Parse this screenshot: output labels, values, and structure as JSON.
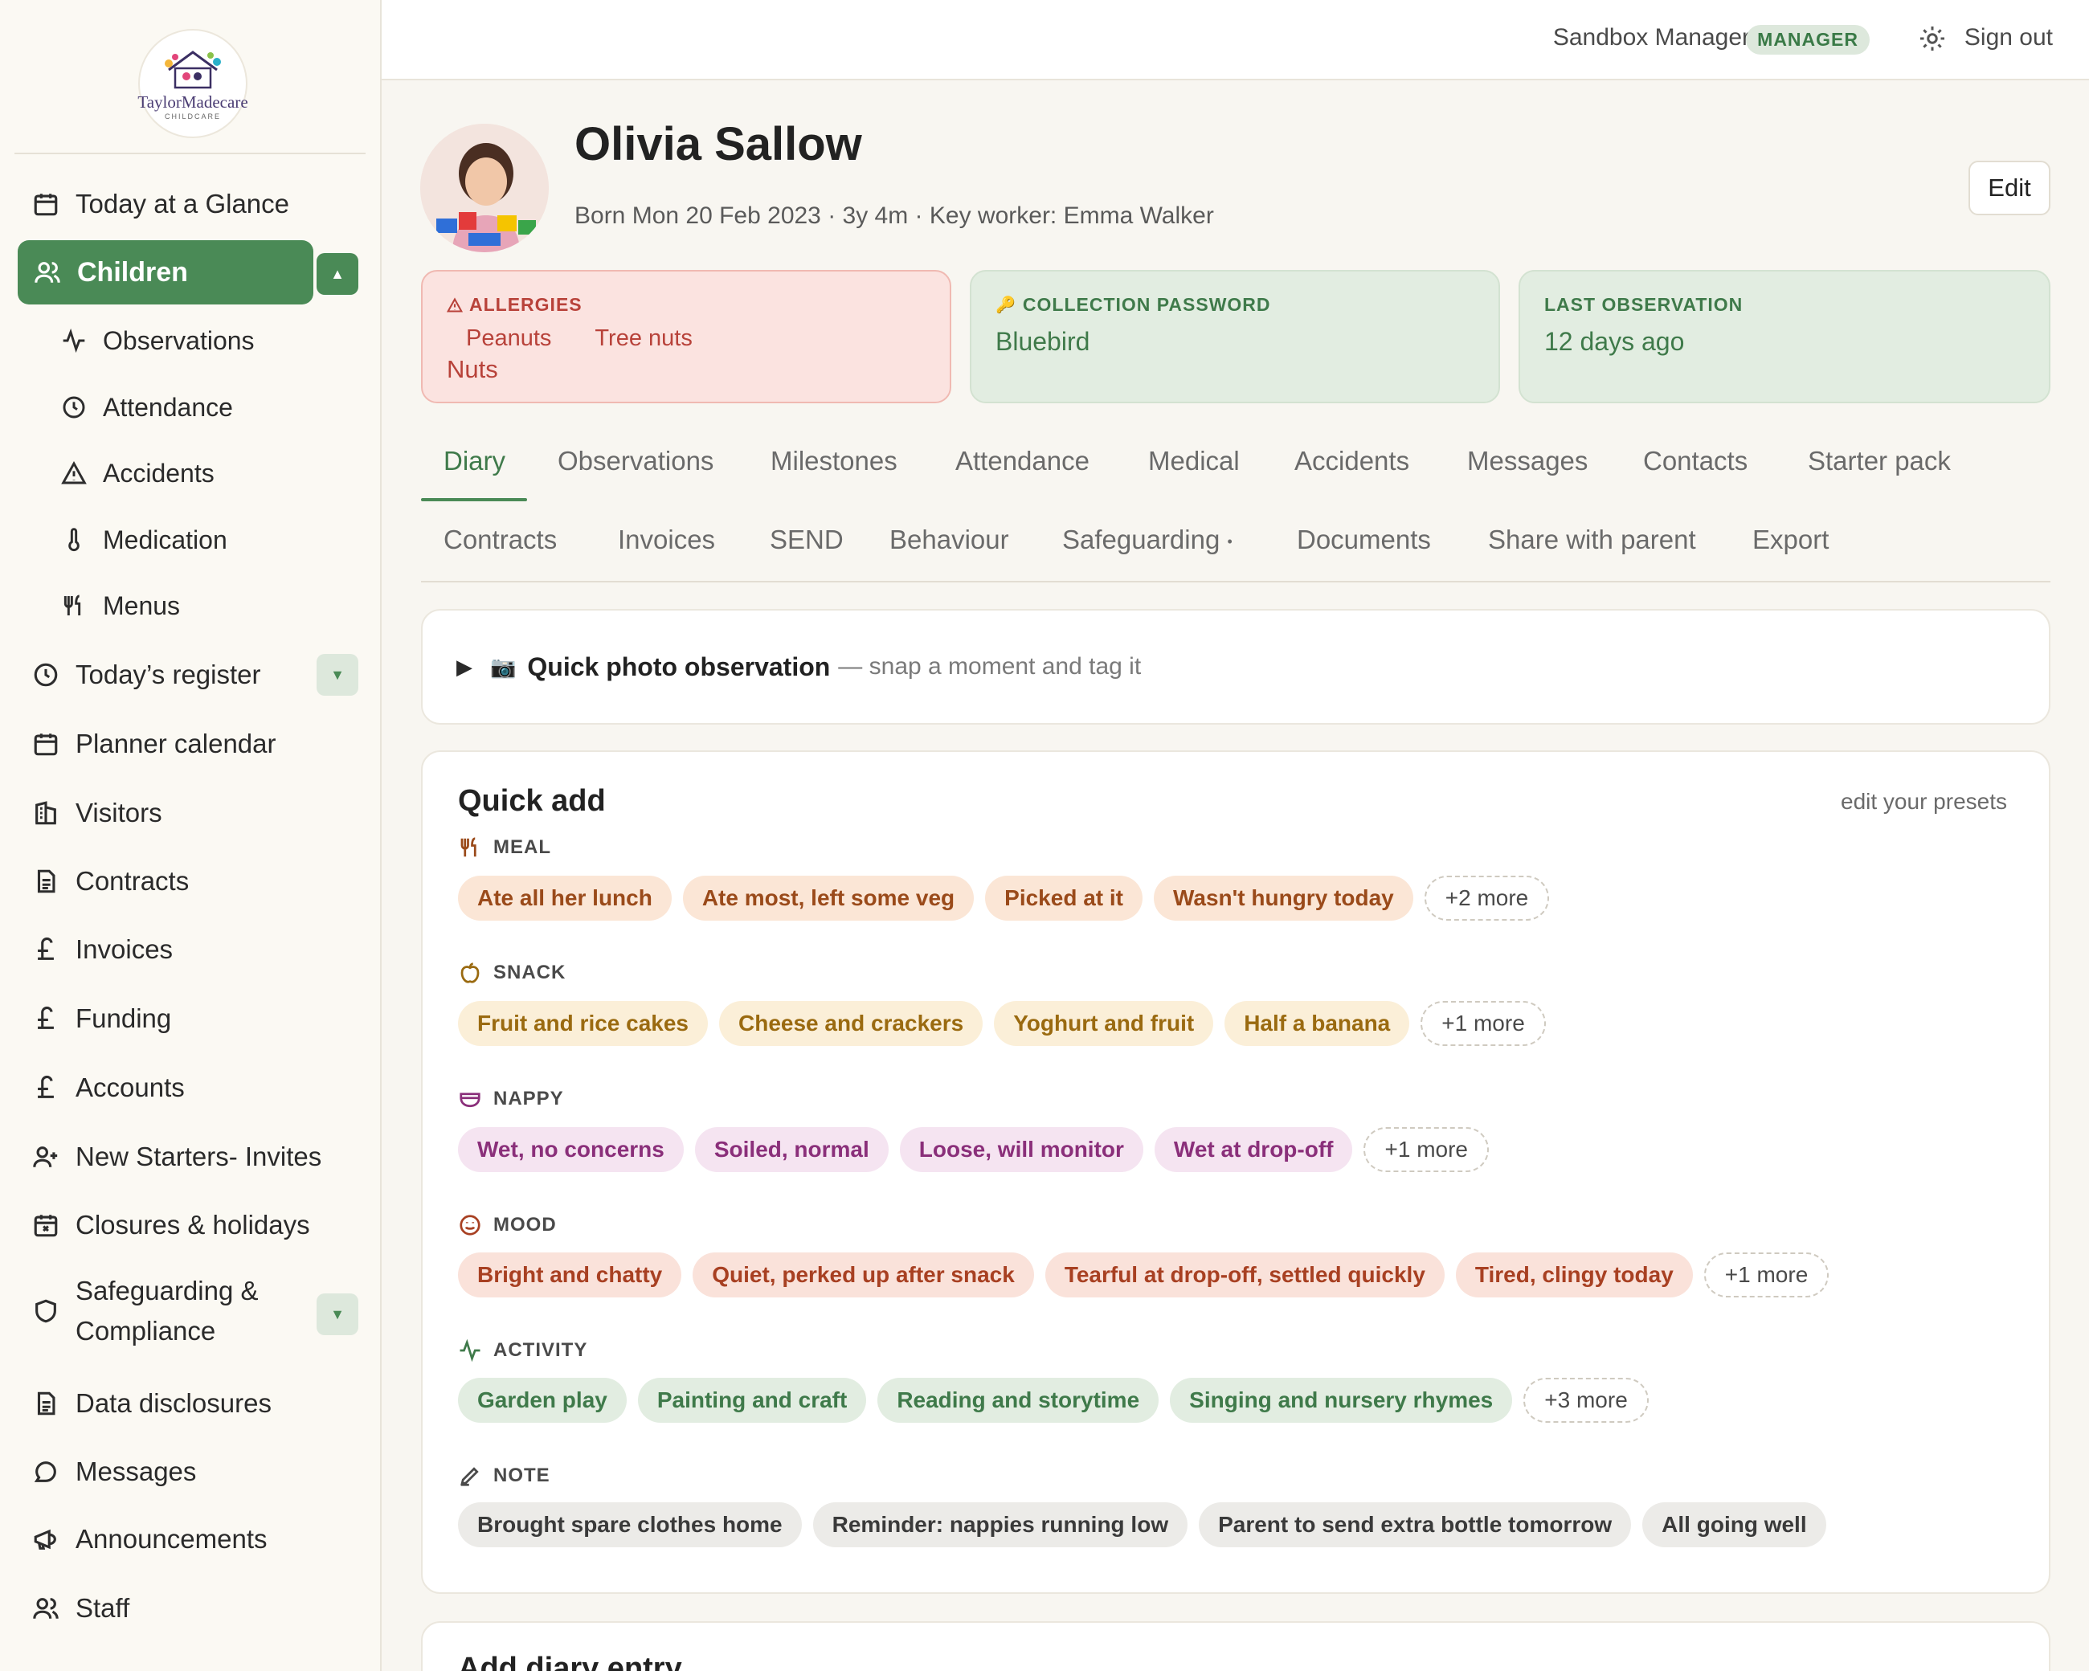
{
  "brand": {
    "name": "TaylorMadecare",
    "sub": "CHILDCARE"
  },
  "sidebar": {
    "items": [
      {
        "label": "Today at a Glance",
        "icon": "calendar-icon"
      },
      {
        "label": "Children",
        "icon": "users-icon",
        "active": true
      },
      {
        "label": "Observations",
        "icon": "activity-icon"
      },
      {
        "label": "Attendance",
        "icon": "clock-icon"
      },
      {
        "label": "Accidents",
        "icon": "warning-icon"
      },
      {
        "label": "Medication",
        "icon": "thermometer-icon"
      },
      {
        "label": "Menus",
        "icon": "utensils-icon"
      },
      {
        "label": "Today’s register",
        "icon": "clock-icon"
      },
      {
        "label": "Planner calendar",
        "icon": "calendar-icon"
      },
      {
        "label": "Visitors",
        "icon": "building-icon"
      },
      {
        "label": "Contracts",
        "icon": "document-icon"
      },
      {
        "label": "Invoices",
        "icon": "pound-icon"
      },
      {
        "label": "Funding",
        "icon": "pound-icon"
      },
      {
        "label": "Accounts",
        "icon": "pound-icon"
      },
      {
        "label": "New Starters- Invites",
        "icon": "user-plus-icon"
      },
      {
        "label": "Closures & holidays",
        "icon": "calendar-x-icon"
      },
      {
        "label": "Safeguarding &",
        "label2": "Compliance",
        "icon": "shield-icon"
      },
      {
        "label": "Data disclosures",
        "icon": "document-icon"
      },
      {
        "label": "Messages",
        "icon": "chat-icon"
      },
      {
        "label": "Announcements",
        "icon": "megaphone-icon"
      },
      {
        "label": "Staff",
        "icon": "users-icon"
      }
    ]
  },
  "topbar": {
    "user": "Sandbox Manager",
    "role": "MANAGER",
    "signout": "Sign out"
  },
  "child": {
    "name": "Olivia Sallow",
    "meta": "Born Mon 20 Feb 2023 · 3y 4m · Key worker: Emma Walker",
    "edit": "Edit"
  },
  "cards": {
    "allergies": {
      "label": "ALLERGIES",
      "tags": [
        "Peanuts",
        "Tree nuts"
      ],
      "value": "Nuts"
    },
    "password": {
      "label": "COLLECTION PASSWORD",
      "value": "Bluebird"
    },
    "observation": {
      "label": "LAST OBSERVATION",
      "value": "12 days ago"
    }
  },
  "tabs": {
    "row1": [
      "Diary",
      "Observations",
      "Milestones",
      "Attendance",
      "Medical",
      "Accidents",
      "Messages",
      "Contacts",
      "Starter pack"
    ],
    "row2": [
      "Contracts",
      "Invoices",
      "SEND",
      "Behaviour",
      "Safeguarding",
      "Documents",
      "Share with parent",
      "Export"
    ],
    "safeguarding_dot": "•"
  },
  "quick_photo": {
    "title": "Quick photo observation",
    "hint": "— snap a moment and tag it"
  },
  "quick_add": {
    "title": "Quick add",
    "presets": "edit your presets",
    "meal": {
      "label": "MEAL",
      "chips": [
        "Ate all her lunch",
        "Ate most, left some veg",
        "Picked at it",
        "Wasn't hungry today"
      ],
      "more": "+2 more"
    },
    "snack": {
      "label": "SNACK",
      "chips": [
        "Fruit and rice cakes",
        "Cheese and crackers",
        "Yoghurt and fruit",
        "Half a banana"
      ],
      "more": "+1 more"
    },
    "nappy": {
      "label": "NAPPY",
      "chips": [
        "Wet, no concerns",
        "Soiled, normal",
        "Loose, will monitor",
        "Wet at drop-off"
      ],
      "more": "+1 more"
    },
    "mood": {
      "label": "MOOD",
      "chips": [
        "Bright and chatty",
        "Quiet, perked up after snack",
        "Tearful at drop-off, settled quickly",
        "Tired, clingy today"
      ],
      "more": "+1 more"
    },
    "activity": {
      "label": "ACTIVITY",
      "chips": [
        "Garden play",
        "Painting and craft",
        "Reading and storytime",
        "Singing and nursery rhymes"
      ],
      "more": "+3 more"
    },
    "note": {
      "label": "NOTE",
      "chips": [
        "Brought spare clothes home",
        "Reminder: nappies running low",
        "Parent to send extra bottle tomorrow",
        "All going well"
      ]
    }
  },
  "diary": {
    "title": "Add diary entry"
  },
  "colors": {
    "accent": "#4a8a56",
    "allergy": "#b8423a",
    "background": "#f8f6f1"
  }
}
